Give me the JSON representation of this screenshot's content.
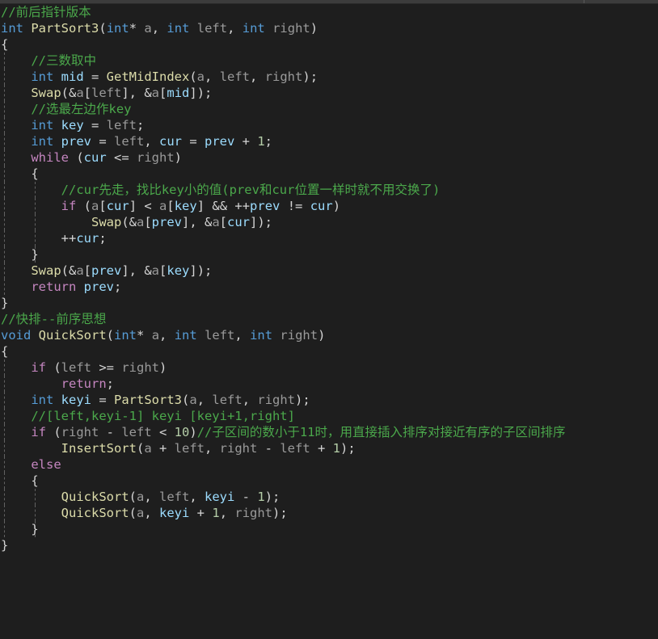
{
  "window": {
    "kind": "code-editor",
    "theme": "dark-plus",
    "language": "C",
    "background": "#1e1e1e",
    "foreground": "#d4d4d4"
  },
  "colors": {
    "keyword": "#569cd6",
    "control": "#c586c0",
    "function": "#dcdcaa",
    "variable": "#9cdcfe",
    "parameter": "#9a9a9a",
    "comment": "#4ba84b",
    "number": "#b5cea8",
    "operator": "#d4d4d4",
    "indent_guide": "#6e6e6e",
    "chrome": "#3c3c3c"
  },
  "code": {
    "lines": [
      {
        "indent": 0,
        "guides": 0,
        "text": "//前后指针版本"
      },
      {
        "indent": 0,
        "guides": 0,
        "text": "int PartSort3(int* a, int left, int right)"
      },
      {
        "indent": 0,
        "guides": 0,
        "text": "{"
      },
      {
        "indent": 1,
        "guides": 1,
        "text": "    //三数取中"
      },
      {
        "indent": 1,
        "guides": 1,
        "text": "    int mid = GetMidIndex(a, left, right);"
      },
      {
        "indent": 1,
        "guides": 1,
        "text": "    Swap(&a[left], &a[mid]);"
      },
      {
        "indent": 1,
        "guides": 1,
        "text": "    //选最左边作key"
      },
      {
        "indent": 1,
        "guides": 1,
        "text": "    int key = left;"
      },
      {
        "indent": 1,
        "guides": 1,
        "text": "    int prev = left, cur = prev + 1;"
      },
      {
        "indent": 1,
        "guides": 1,
        "text": "    while (cur <= right)"
      },
      {
        "indent": 1,
        "guides": 1,
        "text": "    {"
      },
      {
        "indent": 2,
        "guides": 2,
        "text": "        //cur先走，找比key小的值(prev和cur位置一样时就不用交换了)"
      },
      {
        "indent": 2,
        "guides": 2,
        "text": "        if (a[cur] < a[key] && ++prev != cur)"
      },
      {
        "indent": 3,
        "guides": 2,
        "text": "            Swap(&a[prev], &a[cur]);"
      },
      {
        "indent": 2,
        "guides": 2,
        "text": "        ++cur;"
      },
      {
        "indent": 1,
        "guides": 2,
        "text": "    }"
      },
      {
        "indent": 1,
        "guides": 1,
        "text": "    Swap(&a[prev], &a[key]);"
      },
      {
        "indent": 1,
        "guides": 1,
        "text": "    return prev;"
      },
      {
        "indent": 0,
        "guides": 0,
        "text": "}"
      },
      {
        "indent": 0,
        "guides": 0,
        "text": "//快排--前序思想"
      },
      {
        "indent": 0,
        "guides": 0,
        "text": "void QuickSort(int* a, int left, int right)"
      },
      {
        "indent": 0,
        "guides": 0,
        "text": "{"
      },
      {
        "indent": 1,
        "guides": 1,
        "text": "    if (left >= right)"
      },
      {
        "indent": 2,
        "guides": 1,
        "text": "        return;"
      },
      {
        "indent": 1,
        "guides": 1,
        "text": "    int keyi = PartSort3(a, left, right);"
      },
      {
        "indent": 1,
        "guides": 1,
        "text": "    //[left,keyi-1] keyi [keyi+1,right]"
      },
      {
        "indent": 1,
        "guides": 1,
        "text": "    if (right - left < 10)//子区间的数小于11时，用直接插入排序对接近有序的子区间排序"
      },
      {
        "indent": 2,
        "guides": 1,
        "text": "        InsertSort(a + left, right - left + 1);"
      },
      {
        "indent": 1,
        "guides": 1,
        "text": "    else"
      },
      {
        "indent": 1,
        "guides": 1,
        "text": "    {"
      },
      {
        "indent": 2,
        "guides": 2,
        "text": "        QuickSort(a, left, keyi - 1);"
      },
      {
        "indent": 2,
        "guides": 2,
        "text": "        QuickSort(a, keyi + 1, right);"
      },
      {
        "indent": 1,
        "guides": 2,
        "text": "    }"
      },
      {
        "indent": 0,
        "guides": 0,
        "text": "}"
      }
    ],
    "tokens": [
      [
        {
          "t": "//前后指针版本",
          "c": "cm"
        }
      ],
      [
        {
          "t": "int",
          "c": "k"
        },
        {
          "t": " ",
          "c": "op"
        },
        {
          "t": "PartSort3",
          "c": "fn"
        },
        {
          "t": "(",
          "c": "op"
        },
        {
          "t": "int",
          "c": "k"
        },
        {
          "t": "*",
          "c": "op"
        },
        {
          "t": " ",
          "c": "op"
        },
        {
          "t": "a",
          "c": "pm"
        },
        {
          "t": ", ",
          "c": "op"
        },
        {
          "t": "int",
          "c": "k"
        },
        {
          "t": " ",
          "c": "op"
        },
        {
          "t": "left",
          "c": "pm"
        },
        {
          "t": ", ",
          "c": "op"
        },
        {
          "t": "int",
          "c": "k"
        },
        {
          "t": " ",
          "c": "op"
        },
        {
          "t": "right",
          "c": "pm"
        },
        {
          "t": ")",
          "c": "op"
        }
      ],
      [
        {
          "t": "{",
          "c": "op"
        }
      ],
      [
        {
          "t": "    ",
          "c": "op"
        },
        {
          "t": "//三数取中",
          "c": "cm"
        }
      ],
      [
        {
          "t": "    ",
          "c": "op"
        },
        {
          "t": "int",
          "c": "k"
        },
        {
          "t": " ",
          "c": "op"
        },
        {
          "t": "mid",
          "c": "var"
        },
        {
          "t": " = ",
          "c": "op"
        },
        {
          "t": "GetMidIndex",
          "c": "fn"
        },
        {
          "t": "(",
          "c": "op"
        },
        {
          "t": "a",
          "c": "pm"
        },
        {
          "t": ", ",
          "c": "op"
        },
        {
          "t": "left",
          "c": "pm"
        },
        {
          "t": ", ",
          "c": "op"
        },
        {
          "t": "right",
          "c": "pm"
        },
        {
          "t": ");",
          "c": "op"
        }
      ],
      [
        {
          "t": "    ",
          "c": "op"
        },
        {
          "t": "Swap",
          "c": "fn"
        },
        {
          "t": "(&",
          "c": "op"
        },
        {
          "t": "a",
          "c": "pm"
        },
        {
          "t": "[",
          "c": "op"
        },
        {
          "t": "left",
          "c": "pm"
        },
        {
          "t": "], &",
          "c": "op"
        },
        {
          "t": "a",
          "c": "pm"
        },
        {
          "t": "[",
          "c": "op"
        },
        {
          "t": "mid",
          "c": "var"
        },
        {
          "t": "]);",
          "c": "op"
        }
      ],
      [
        {
          "t": "    ",
          "c": "op"
        },
        {
          "t": "//选最左边作key",
          "c": "cm"
        }
      ],
      [
        {
          "t": "    ",
          "c": "op"
        },
        {
          "t": "int",
          "c": "k"
        },
        {
          "t": " ",
          "c": "op"
        },
        {
          "t": "key",
          "c": "var"
        },
        {
          "t": " = ",
          "c": "op"
        },
        {
          "t": "left",
          "c": "pm"
        },
        {
          "t": ";",
          "c": "op"
        }
      ],
      [
        {
          "t": "    ",
          "c": "op"
        },
        {
          "t": "int",
          "c": "k"
        },
        {
          "t": " ",
          "c": "op"
        },
        {
          "t": "prev",
          "c": "var"
        },
        {
          "t": " = ",
          "c": "op"
        },
        {
          "t": "left",
          "c": "pm"
        },
        {
          "t": ", ",
          "c": "op"
        },
        {
          "t": "cur",
          "c": "var"
        },
        {
          "t": " = ",
          "c": "op"
        },
        {
          "t": "prev",
          "c": "var"
        },
        {
          "t": " + ",
          "c": "op"
        },
        {
          "t": "1",
          "c": "num"
        },
        {
          "t": ";",
          "c": "op"
        }
      ],
      [
        {
          "t": "    ",
          "c": "op"
        },
        {
          "t": "while",
          "c": "ctl"
        },
        {
          "t": " (",
          "c": "op"
        },
        {
          "t": "cur",
          "c": "var"
        },
        {
          "t": " <= ",
          "c": "op"
        },
        {
          "t": "right",
          "c": "pm"
        },
        {
          "t": ")",
          "c": "op"
        }
      ],
      [
        {
          "t": "    {",
          "c": "op"
        }
      ],
      [
        {
          "t": "        ",
          "c": "op"
        },
        {
          "t": "//cur先走，找比key小的值(prev和cur位置一样时就不用交换了)",
          "c": "cm"
        }
      ],
      [
        {
          "t": "        ",
          "c": "op"
        },
        {
          "t": "if",
          "c": "ctl"
        },
        {
          "t": " (",
          "c": "op"
        },
        {
          "t": "a",
          "c": "pm"
        },
        {
          "t": "[",
          "c": "op"
        },
        {
          "t": "cur",
          "c": "var"
        },
        {
          "t": "] < ",
          "c": "op"
        },
        {
          "t": "a",
          "c": "pm"
        },
        {
          "t": "[",
          "c": "op"
        },
        {
          "t": "key",
          "c": "var"
        },
        {
          "t": "] && ++",
          "c": "op"
        },
        {
          "t": "prev",
          "c": "var"
        },
        {
          "t": " != ",
          "c": "op"
        },
        {
          "t": "cur",
          "c": "var"
        },
        {
          "t": ")",
          "c": "op"
        }
      ],
      [
        {
          "t": "            ",
          "c": "op"
        },
        {
          "t": "Swap",
          "c": "fn"
        },
        {
          "t": "(&",
          "c": "op"
        },
        {
          "t": "a",
          "c": "pm"
        },
        {
          "t": "[",
          "c": "op"
        },
        {
          "t": "prev",
          "c": "var"
        },
        {
          "t": "], &",
          "c": "op"
        },
        {
          "t": "a",
          "c": "pm"
        },
        {
          "t": "[",
          "c": "op"
        },
        {
          "t": "cur",
          "c": "var"
        },
        {
          "t": "]);",
          "c": "op"
        }
      ],
      [
        {
          "t": "        ++",
          "c": "op"
        },
        {
          "t": "cur",
          "c": "var"
        },
        {
          "t": ";",
          "c": "op"
        }
      ],
      [
        {
          "t": "    }",
          "c": "op"
        }
      ],
      [
        {
          "t": "    ",
          "c": "op"
        },
        {
          "t": "Swap",
          "c": "fn"
        },
        {
          "t": "(&",
          "c": "op"
        },
        {
          "t": "a",
          "c": "pm"
        },
        {
          "t": "[",
          "c": "op"
        },
        {
          "t": "prev",
          "c": "var"
        },
        {
          "t": "], &",
          "c": "op"
        },
        {
          "t": "a",
          "c": "pm"
        },
        {
          "t": "[",
          "c": "op"
        },
        {
          "t": "key",
          "c": "var"
        },
        {
          "t": "]);",
          "c": "op"
        }
      ],
      [
        {
          "t": "    ",
          "c": "op"
        },
        {
          "t": "return",
          "c": "ctl"
        },
        {
          "t": " ",
          "c": "op"
        },
        {
          "t": "prev",
          "c": "var"
        },
        {
          "t": ";",
          "c": "op"
        }
      ],
      [
        {
          "t": "}",
          "c": "op"
        }
      ],
      [
        {
          "t": "//快排--前序思想",
          "c": "cm"
        }
      ],
      [
        {
          "t": "void",
          "c": "k"
        },
        {
          "t": " ",
          "c": "op"
        },
        {
          "t": "QuickSort",
          "c": "fn"
        },
        {
          "t": "(",
          "c": "op"
        },
        {
          "t": "int",
          "c": "k"
        },
        {
          "t": "*",
          "c": "op"
        },
        {
          "t": " ",
          "c": "op"
        },
        {
          "t": "a",
          "c": "pm"
        },
        {
          "t": ", ",
          "c": "op"
        },
        {
          "t": "int",
          "c": "k"
        },
        {
          "t": " ",
          "c": "op"
        },
        {
          "t": "left",
          "c": "pm"
        },
        {
          "t": ", ",
          "c": "op"
        },
        {
          "t": "int",
          "c": "k"
        },
        {
          "t": " ",
          "c": "op"
        },
        {
          "t": "right",
          "c": "pm"
        },
        {
          "t": ")",
          "c": "op"
        }
      ],
      [
        {
          "t": "{",
          "c": "op"
        }
      ],
      [
        {
          "t": "    ",
          "c": "op"
        },
        {
          "t": "if",
          "c": "ctl"
        },
        {
          "t": " (",
          "c": "op"
        },
        {
          "t": "left",
          "c": "pm"
        },
        {
          "t": " >= ",
          "c": "op"
        },
        {
          "t": "right",
          "c": "pm"
        },
        {
          "t": ")",
          "c": "op"
        }
      ],
      [
        {
          "t": "        ",
          "c": "op"
        },
        {
          "t": "return",
          "c": "ctl"
        },
        {
          "t": ";",
          "c": "op"
        }
      ],
      [
        {
          "t": "    ",
          "c": "op"
        },
        {
          "t": "int",
          "c": "k"
        },
        {
          "t": " ",
          "c": "op"
        },
        {
          "t": "keyi",
          "c": "var"
        },
        {
          "t": " = ",
          "c": "op"
        },
        {
          "t": "PartSort3",
          "c": "fn"
        },
        {
          "t": "(",
          "c": "op"
        },
        {
          "t": "a",
          "c": "pm"
        },
        {
          "t": ", ",
          "c": "op"
        },
        {
          "t": "left",
          "c": "pm"
        },
        {
          "t": ", ",
          "c": "op"
        },
        {
          "t": "right",
          "c": "pm"
        },
        {
          "t": ");",
          "c": "op"
        }
      ],
      [
        {
          "t": "    ",
          "c": "op"
        },
        {
          "t": "//[left,keyi-1] keyi [keyi+1,right]",
          "c": "cm"
        }
      ],
      [
        {
          "t": "    ",
          "c": "op"
        },
        {
          "t": "if",
          "c": "ctl"
        },
        {
          "t": " (",
          "c": "op"
        },
        {
          "t": "right",
          "c": "pm"
        },
        {
          "t": " - ",
          "c": "op"
        },
        {
          "t": "left",
          "c": "pm"
        },
        {
          "t": " < ",
          "c": "op"
        },
        {
          "t": "10",
          "c": "num"
        },
        {
          "t": ")",
          "c": "op"
        },
        {
          "t": "//子区间的数小于11时，用直接插入排序对接近有序的子区间排序",
          "c": "cm"
        }
      ],
      [
        {
          "t": "        ",
          "c": "op"
        },
        {
          "t": "InsertSort",
          "c": "fn"
        },
        {
          "t": "(",
          "c": "op"
        },
        {
          "t": "a",
          "c": "pm"
        },
        {
          "t": " + ",
          "c": "op"
        },
        {
          "t": "left",
          "c": "pm"
        },
        {
          "t": ", ",
          "c": "op"
        },
        {
          "t": "right",
          "c": "pm"
        },
        {
          "t": " - ",
          "c": "op"
        },
        {
          "t": "left",
          "c": "pm"
        },
        {
          "t": " + ",
          "c": "op"
        },
        {
          "t": "1",
          "c": "num"
        },
        {
          "t": ");",
          "c": "op"
        }
      ],
      [
        {
          "t": "    ",
          "c": "op"
        },
        {
          "t": "else",
          "c": "ctl"
        }
      ],
      [
        {
          "t": "    {",
          "c": "op"
        }
      ],
      [
        {
          "t": "        ",
          "c": "op"
        },
        {
          "t": "QuickSort",
          "c": "fn"
        },
        {
          "t": "(",
          "c": "op"
        },
        {
          "t": "a",
          "c": "pm"
        },
        {
          "t": ", ",
          "c": "op"
        },
        {
          "t": "left",
          "c": "pm"
        },
        {
          "t": ", ",
          "c": "op"
        },
        {
          "t": "keyi",
          "c": "var"
        },
        {
          "t": " - ",
          "c": "op"
        },
        {
          "t": "1",
          "c": "num"
        },
        {
          "t": ");",
          "c": "op"
        }
      ],
      [
        {
          "t": "        ",
          "c": "op"
        },
        {
          "t": "QuickSort",
          "c": "fn"
        },
        {
          "t": "(",
          "c": "op"
        },
        {
          "t": "a",
          "c": "pm"
        },
        {
          "t": ", ",
          "c": "op"
        },
        {
          "t": "keyi",
          "c": "var"
        },
        {
          "t": " + ",
          "c": "op"
        },
        {
          "t": "1",
          "c": "num"
        },
        {
          "t": ", ",
          "c": "op"
        },
        {
          "t": "right",
          "c": "pm"
        },
        {
          "t": ");",
          "c": "op"
        }
      ],
      [
        {
          "t": "    }",
          "c": "op"
        }
      ],
      [
        {
          "t": "}",
          "c": "op"
        }
      ]
    ]
  }
}
